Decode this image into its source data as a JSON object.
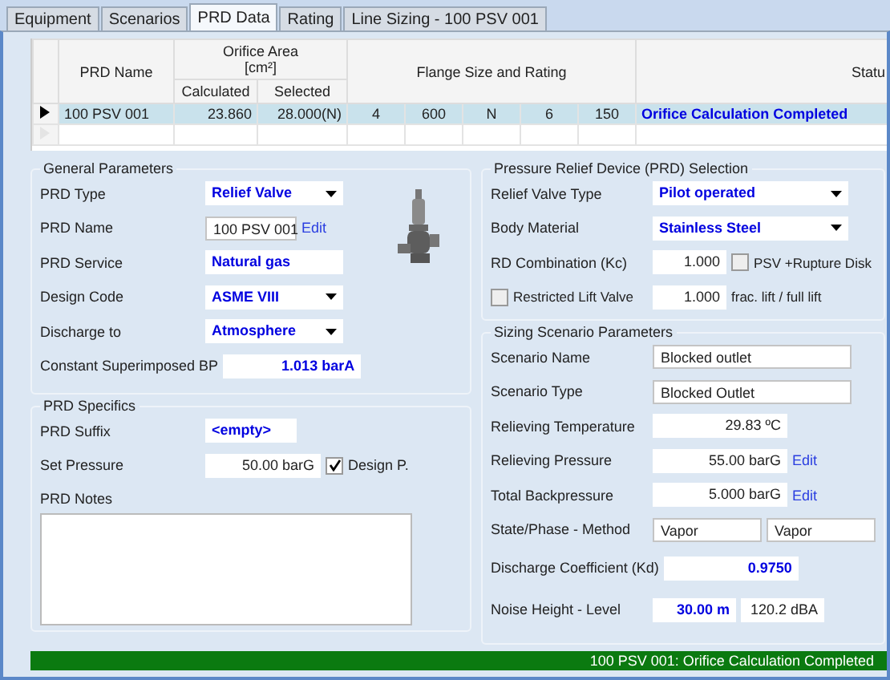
{
  "tabs": [
    {
      "label": "Equipment",
      "selected": false
    },
    {
      "label": "Scenarios",
      "selected": false
    },
    {
      "label": "PRD Data",
      "selected": true
    },
    {
      "label": "Rating",
      "selected": false
    },
    {
      "label": "Line Sizing - 100 PSV 001",
      "selected": false
    }
  ],
  "grid": {
    "headers": {
      "name": "PRD Name",
      "orifice": "Orifice Area",
      "unit": "[cm²]",
      "calculated": "Calculated",
      "selected": "Selected",
      "flange": "Flange Size and Rating",
      "status": "Statu"
    },
    "rows": [
      {
        "current": true,
        "name": "100 PSV 001",
        "calculated": "23.860",
        "selected": "28.000(N)",
        "flange": [
          "4",
          "600",
          "N",
          "6",
          "150"
        ],
        "status": "Orifice Calculation Completed"
      }
    ]
  },
  "general": {
    "title": "General Parameters",
    "fields": [
      {
        "label": "PRD Type",
        "values": [
          {
            "kind": "dropdown",
            "text": "Relief Valve"
          }
        ]
      },
      {
        "label": "PRD Name",
        "values": [
          {
            "kind": "input",
            "text": "100 PSV 001"
          }
        ],
        "link": "Edit"
      },
      {
        "label": "PRD Service",
        "values": [
          {
            "kind": "emphasis",
            "text": "Natural gas"
          }
        ]
      },
      {
        "label": "Design Code",
        "values": [
          {
            "kind": "dropdown",
            "text": "ASME VIII"
          }
        ]
      },
      {
        "label": "Discharge to",
        "values": [
          {
            "kind": "dropdown",
            "text": "Atmosphere"
          }
        ]
      },
      {
        "label": "Constant Superimposed BP",
        "values": [
          {
            "kind": "number-emphasis",
            "text": "1.013 barA"
          }
        ]
      }
    ]
  },
  "specifics": {
    "title": "PRD Specifics",
    "fields": [
      {
        "label": "PRD Suffix",
        "values": [
          {
            "kind": "emphasis",
            "text": "<empty>"
          }
        ]
      },
      {
        "label": "Set Pressure",
        "values": [
          {
            "kind": "number",
            "text": "50.00 barG"
          }
        ],
        "checkbox": {
          "label": "Design P.",
          "checked": true
        }
      }
    ],
    "notes_label": "PRD Notes"
  },
  "selection": {
    "title": "Pressure Relief Device (PRD) Selection",
    "fields": [
      {
        "label": "Relief Valve Type",
        "values": [
          {
            "kind": "dropdown",
            "text": "Pilot operated"
          }
        ]
      },
      {
        "label": "Body Material",
        "values": [
          {
            "kind": "dropdown",
            "text": "Stainless Steel"
          }
        ]
      },
      {
        "label": "RD Combination (Kc)",
        "values": [
          {
            "kind": "number",
            "text": "1.000"
          }
        ],
        "checkbox": {
          "label": "PSV +Rupture Disk",
          "checked": false
        }
      },
      {
        "label": "Restricted Lift Valve",
        "checked": false,
        "values": [
          {
            "kind": "number",
            "text": "1.000"
          }
        ],
        "suffix": "frac. lift / full lift"
      }
    ]
  },
  "scenario": {
    "title": "Sizing Scenario Parameters",
    "fields": [
      {
        "label": "Scenario Name",
        "values": [
          {
            "kind": "input",
            "text": "Blocked outlet"
          }
        ]
      },
      {
        "label": "Scenario Type",
        "values": [
          {
            "kind": "input",
            "text": "Blocked Outlet"
          }
        ]
      },
      {
        "label": "Relieving Temperature",
        "values": [
          {
            "kind": "number",
            "text": "29.83 ºC"
          }
        ]
      },
      {
        "label": "Relieving Pressure",
        "values": [
          {
            "kind": "number",
            "text": "55.00 barG"
          }
        ],
        "link": "Edit"
      },
      {
        "label": "Total Backpressure",
        "values": [
          {
            "kind": "number",
            "text": "5.000 barG"
          }
        ],
        "link": "Edit"
      },
      {
        "label": "State/Phase - Method",
        "values": [
          {
            "kind": "input",
            "text": "Vapor"
          },
          {
            "kind": "input",
            "text": "Vapor"
          }
        ]
      },
      {
        "label": "Discharge Coefficient (Kd)",
        "values": [
          {
            "kind": "number-emphasis",
            "text": "0.9750"
          }
        ]
      },
      {
        "label": "Noise Height - Level",
        "values": [
          {
            "kind": "number-emphasis",
            "text": "30.00 m"
          },
          {
            "kind": "number",
            "text": "120.2 dBA"
          }
        ]
      }
    ]
  },
  "status_bar": "100 PSV 001: Orifice Calculation Completed"
}
